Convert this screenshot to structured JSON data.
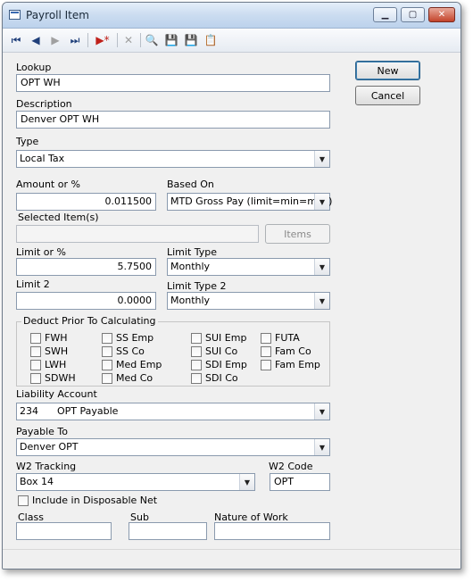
{
  "window": {
    "title": "Payroll Item"
  },
  "toolbar": {
    "icons": [
      "first-record-icon",
      "previous-record-icon",
      "next-record-icon",
      "last-record-icon",
      "new-record-icon",
      "delete-icon",
      "find-icon",
      "save-icon",
      "save-close-icon",
      "properties-icon"
    ],
    "glyphs": {
      "first": "⏮",
      "prev": "◀",
      "next": "▶",
      "last": "⏭",
      "new": "▶*",
      "delete": "✕",
      "find": "🔍",
      "save": "💾",
      "save_close": "💾",
      "props": "📋"
    }
  },
  "buttons": {
    "new": "New",
    "cancel": "Cancel",
    "items": "Items"
  },
  "form": {
    "lookup_label": "Lookup",
    "lookup_value": "OPT WH",
    "description_label": "Description",
    "description_value": "Denver OPT WH",
    "type_label": "Type",
    "type_value": "Local Tax",
    "amount_label": "Amount or %",
    "amount_value": "0.011500",
    "based_on_label": "Based On",
    "based_on_value": "MTD Gross Pay (limit=min=max)",
    "selected_items_label": "Selected Item(s)",
    "selected_items_value": "",
    "limit_label": "Limit or %",
    "limit_value": "5.7500",
    "limit_type_label": "Limit Type",
    "limit_type_value": "Monthly",
    "limit2_label": "Limit 2",
    "limit2_value": "0.0000",
    "limit_type2_label": "Limit Type 2",
    "limit_type2_value": "Monthly",
    "deduct_title": "Deduct Prior To Calculating",
    "deduct_items": [
      {
        "label": "FWH",
        "checked": false
      },
      {
        "label": "SWH",
        "checked": false
      },
      {
        "label": "LWH",
        "checked": false
      },
      {
        "label": "SDWH",
        "checked": false
      },
      {
        "label": "SS Emp",
        "checked": false
      },
      {
        "label": "SS Co",
        "checked": false
      },
      {
        "label": "Med Emp",
        "checked": false
      },
      {
        "label": "Med Co",
        "checked": false
      },
      {
        "label": "SUI Emp",
        "checked": false
      },
      {
        "label": "SUI Co",
        "checked": false
      },
      {
        "label": "SDI Emp",
        "checked": false
      },
      {
        "label": "SDI Co",
        "checked": false
      },
      {
        "label": "FUTA",
        "checked": false
      },
      {
        "label": "Fam Co",
        "checked": false
      },
      {
        "label": "Fam Emp",
        "checked": false
      }
    ],
    "liability_label": "Liability Account",
    "liability_value": "234      OPT Payable",
    "payable_to_label": "Payable To",
    "payable_to_value": "Denver OPT",
    "w2_tracking_label": "W2 Tracking",
    "w2_tracking_value": "Box 14",
    "w2_code_label": "W2 Code",
    "w2_code_value": "OPT",
    "disposable_label": "Include in Disposable Net",
    "disposable_checked": false,
    "class_label": "Class",
    "class_value": "",
    "sub_label": "Sub",
    "sub_value": "",
    "nature_label": "Nature of Work",
    "nature_value": ""
  }
}
